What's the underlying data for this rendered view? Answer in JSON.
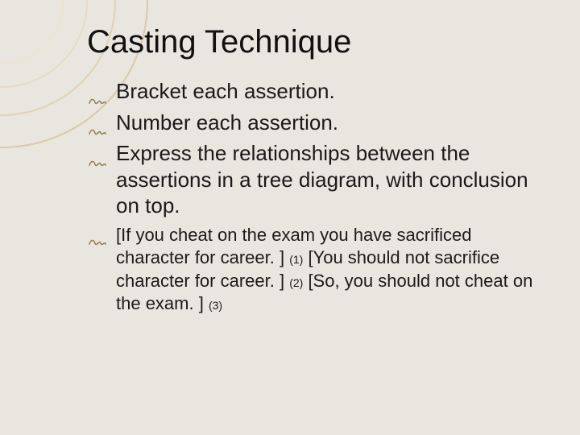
{
  "title": "Casting Technique",
  "bullets": {
    "primary": [
      "Bracket each assertion.",
      "Number each assertion.",
      "Express the relationships between the assertions in a tree diagram, with conclusion on top."
    ],
    "example": {
      "p1": "[If you cheat on the exam you have sacrificed character for career. ] ",
      "n1": "(1)",
      "p2": " [You should not sacrifice character for career. ] ",
      "n2": "(2)",
      "p3": " [So, you should not cheat on the exam. ] ",
      "n3": "(3)"
    }
  },
  "icons": {
    "bullet": "scribble-bullet"
  }
}
